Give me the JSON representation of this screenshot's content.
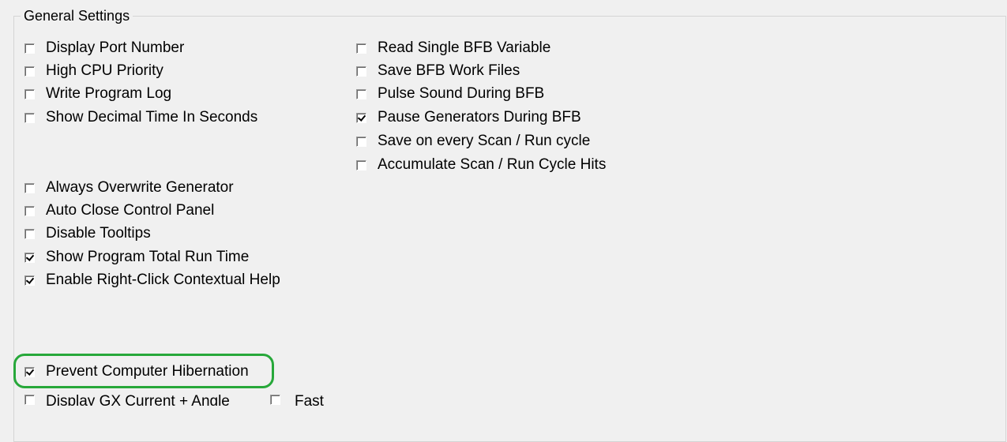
{
  "group": {
    "title": "General Settings"
  },
  "left_col_top": [
    {
      "label": "Display Port Number",
      "checked": false
    },
    {
      "label": "High CPU Priority",
      "checked": false
    },
    {
      "label": "Write Program Log",
      "checked": false
    },
    {
      "label": "Show Decimal Time In Seconds",
      "checked": false
    }
  ],
  "right_col": [
    {
      "label": "Read Single BFB Variable",
      "checked": false
    },
    {
      "label": "Save BFB Work Files",
      "checked": false
    },
    {
      "label": "Pulse Sound During BFB",
      "checked": false
    },
    {
      "label": "Pause Generators During BFB",
      "checked": true
    },
    {
      "label": "Save on every Scan / Run cycle",
      "checked": false
    },
    {
      "label": "Accumulate Scan / Run Cycle Hits",
      "checked": false
    }
  ],
  "left_col_mid": [
    {
      "label": "Always Overwrite Generator",
      "checked": false
    },
    {
      "label": "Auto Close Control Panel",
      "checked": false
    },
    {
      "label": "Disable Tooltips",
      "checked": false
    },
    {
      "label": "Show Program Total Run Time",
      "checked": true
    },
    {
      "label": "Enable Right-Click Contextual Help",
      "checked": true
    }
  ],
  "bottom": {
    "prevent_hibernation": {
      "label": "Prevent Computer Hibernation",
      "checked": true
    },
    "display_gx": {
      "label": "Display GX Current + Angle",
      "checked": false
    },
    "fast": {
      "label": "Fast",
      "checked": false
    }
  },
  "colors": {
    "background": "#f0f0f0",
    "highlight": "#27a83a"
  }
}
